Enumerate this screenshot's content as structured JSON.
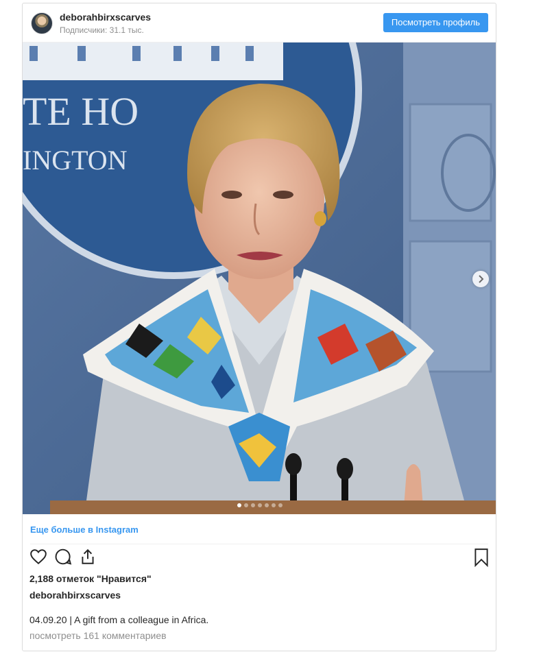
{
  "header": {
    "username": "deborahbirxscarves",
    "followers": "Подписчики: 31.1 тыс.",
    "profile_button": "Посмотреть профиль"
  },
  "media": {
    "backdrop_text_1": "TE HO",
    "backdrop_text_2": "INGTON",
    "slide_count": 7,
    "active_slide": 1
  },
  "more_link": "Еще больше в Instagram",
  "icons": [
    "heart-icon",
    "comment-icon",
    "share-icon",
    "bookmark-icon",
    "chevron-right-icon"
  ],
  "likes": "2,188 отметок \"Нравится\"",
  "caption_username": "deborahbirxscarves",
  "caption": "04.09.20 | A gift from a colleague in Africa.",
  "comments_link": "посмотреть 161 комментариев",
  "colors": {
    "accent": "#3897f0",
    "muted": "#8e8e8e",
    "text": "#262626"
  }
}
